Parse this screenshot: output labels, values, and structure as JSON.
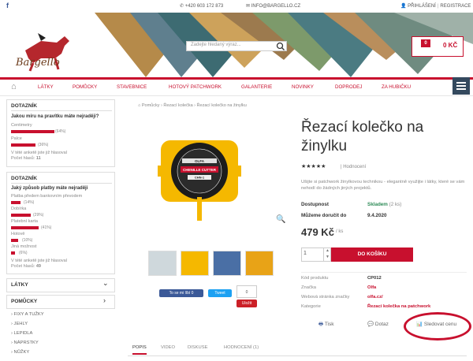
{
  "topbar": {
    "facebook_icon": "f",
    "phone": "+420 603 172 873",
    "email": "INFO@BARGELLO.CZ",
    "login": "PŘIHLÁŠENÍ",
    "register": "REGISTRACE"
  },
  "header": {
    "logo_text": "Bargello",
    "search_placeholder": "Zadejte hledaný výraz...",
    "cart_count": "0",
    "cart_amount": "0 KČ"
  },
  "nav": {
    "items": [
      "LÁTKY",
      "POMŮCKY",
      "STAVEBNICE",
      "HOTOVÝ PATCHWORK",
      "GALANTERIE",
      "NOVINKY",
      "DOPRODEJ",
      "ZA HUBIČKU"
    ]
  },
  "poll1": {
    "title": "DOTAZNÍK",
    "question": "Jakou míru na pravítku máte nejraději?",
    "options": [
      {
        "label": "Centimetry",
        "pct": "(64%)",
        "value": 64
      },
      {
        "label": "Palce",
        "pct": "(36%)",
        "value": 36
      }
    ],
    "footer1": "V tété anketě jste již hlasoval",
    "footer2_label": "Počet hlasů:",
    "footer2_value": "11"
  },
  "poll2": {
    "title": "DOTAZNÍK",
    "question": "Jaký způsob platby máte nejraději",
    "options": [
      {
        "label": "Platba předem bankovním převodem",
        "pct": "(14%)",
        "value": 14
      },
      {
        "label": "Dobírka",
        "pct": "(29%)",
        "value": 29
      },
      {
        "label": "Platební karta",
        "pct": "(41%)",
        "value": 41
      },
      {
        "label": "Hotově",
        "pct": "(10%)",
        "value": 10
      },
      {
        "label": "Jiná možnost",
        "pct": "(6%)",
        "value": 6
      }
    ],
    "footer1": "V tété anketě jste již hlasoval",
    "footer2_label": "Počet hlasů:",
    "footer2_value": "49"
  },
  "sidebar_categories": [
    {
      "label": "LÁTKY",
      "arrow": "⌄"
    },
    {
      "label": "POMŮCKY",
      "arrow": "›"
    }
  ],
  "sidebar_subitems": [
    "› FIXY A TUŽKY",
    "› JEHLY",
    "› LEPIDLA",
    "› NÁPRSTKY",
    "› NŮŽKY"
  ],
  "breadcrumb": "Pomůcky › Řezací kolečka › Řezací kolečko na žinylku",
  "product": {
    "title_line1": "Řezací kolečko na",
    "title_line2": "žinylku",
    "stars": "★★★★★",
    "reviews": "| Hodnocení",
    "description": "Ušijte si patchwork žinylkovou technikou - elegantně využijte i látky, které se vám nehodí do žádných jiných projektů.",
    "availability_label": "Dostupnost",
    "availability_value": "Skladem",
    "availability_count": "(2 ks)",
    "delivery_label": "Můžeme doručit do",
    "delivery_value": "9.4.2020",
    "price": "479 Kč",
    "price_unit": "/ ks",
    "qty": "1",
    "add_to_cart": "DO KOŠÍKU",
    "params": [
      {
        "label": "Kód produktu",
        "value": "CP012"
      },
      {
        "label": "Značka",
        "value": "Olfa"
      },
      {
        "label": "Webová stránka značky",
        "value": "olfa.cz/"
      },
      {
        "label": "Kategorie",
        "value": "Řezací kolečka na patchwork"
      }
    ],
    "actions": {
      "print": "Tisk",
      "question": "Dotaz",
      "watch": "Sledovat cenu"
    },
    "image_brand": "OLFA",
    "image_product": "CHENILLE CUTTER",
    "image_model": "CHN-1"
  },
  "share": {
    "fb": "To se mi líbí 0",
    "tweet": "Tweet",
    "count": "0",
    "pin": "Uložit"
  },
  "tabs": [
    "POPIS",
    "VIDEO",
    "DISKUSE",
    "HODNOCENÍ (1)"
  ],
  "colors": {
    "accent": "#c8102e",
    "nav_menu": "#34495e",
    "available": "#2e8b57"
  }
}
